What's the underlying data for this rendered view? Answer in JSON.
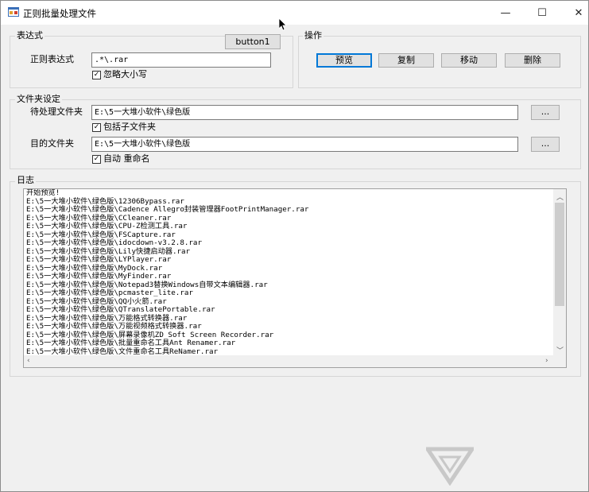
{
  "window": {
    "title": "正则批量处理文件",
    "minimize_glyph": "—",
    "maximize_glyph": "☐",
    "close_glyph": "✕"
  },
  "expression_group": {
    "title": "表达式",
    "button1_label": "button1",
    "regex_label": "正则表达式",
    "regex_value": ".*\\.rar",
    "ignore_case_label": "忽略大小写",
    "ignore_case_checked": true
  },
  "operations_group": {
    "title": "操作",
    "preview_label": "预览",
    "copy_label": "复制",
    "move_label": "移动",
    "delete_label": "删除"
  },
  "folder_group": {
    "title": "文件夹设定",
    "source_label": "待处理文件夹",
    "source_value": "E:\\5一大堆小软件\\绿色版",
    "browse_source_label": "...",
    "include_subfolders_label": "包括子文件夹",
    "include_subfolders_checked": true,
    "target_label": "目的文件夹",
    "target_value": "E:\\5一大堆小软件\\绿色版",
    "browse_target_label": "...",
    "auto_rename_label": "自动 重命名",
    "auto_rename_checked": true
  },
  "log_group": {
    "title": "日志",
    "lines": [
      "开始预览!",
      "E:\\5一大堆小软件\\绿色版\\12306Bypass.rar",
      "E:\\5一大堆小软件\\绿色版\\Cadence Allegro封装管理器FootPrintManager.rar",
      "E:\\5一大堆小软件\\绿色版\\CCleaner.rar",
      "E:\\5一大堆小软件\\绿色版\\CPU-Z检测工具.rar",
      "E:\\5一大堆小软件\\绿色版\\FSCapture.rar",
      "E:\\5一大堆小软件\\绿色版\\idocdown-v3.2.8.rar",
      "E:\\5一大堆小软件\\绿色版\\Lily快捷启动器.rar",
      "E:\\5一大堆小软件\\绿色版\\LYPlayer.rar",
      "E:\\5一大堆小软件\\绿色版\\MyDock.rar",
      "E:\\5一大堆小软件\\绿色版\\MyFinder.rar",
      "E:\\5一大堆小软件\\绿色版\\Notepad3替换Windows自带文本编辑器.rar",
      "E:\\5一大堆小软件\\绿色版\\pcmaster_lite.rar",
      "E:\\5一大堆小软件\\绿色版\\QQ小火箭.rar",
      "E:\\5一大堆小软件\\绿色版\\QTranslatePortable.rar",
      "E:\\5一大堆小软件\\绿色版\\万能格式转换器.rar",
      "E:\\5一大堆小软件\\绿色版\\万能视频格式转换器.rar",
      "E:\\5一大堆小软件\\绿色版\\屏幕录像机ZD Soft Screen Recorder.rar",
      "E:\\5一大堆小软件\\绿色版\\批量重命名工具Ant Renamer.rar",
      "E:\\5一大堆小软件\\绿色版\\文件重命名工具ReNamer.rar"
    ]
  },
  "colors": {
    "window_bg": "#f0f0f0",
    "default_button_border": "#0078d7",
    "watermark": "#c8c8c8"
  },
  "icons": [
    "app-icon",
    "minimize-icon",
    "maximize-icon",
    "close-icon",
    "mouse-cursor-icon",
    "checkbox-check-icon",
    "scroll-up-icon",
    "scroll-down-icon",
    "scroll-left-icon",
    "scroll-right-icon",
    "watermark-logo-icon"
  ]
}
